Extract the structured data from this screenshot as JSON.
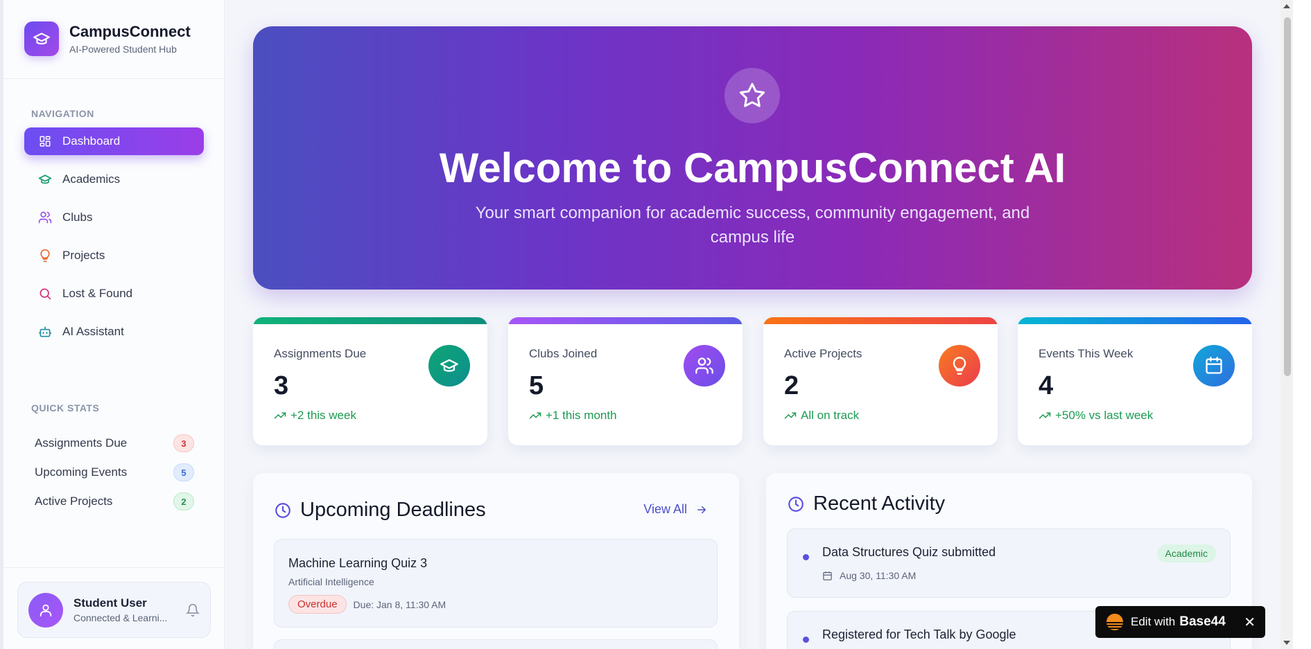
{
  "brand": {
    "name": "CampusConnect",
    "tagline": "AI-Powered Student Hub",
    "logo_icon": "graduation-cap-icon"
  },
  "sidebar": {
    "nav_label": "NAVIGATION",
    "items": [
      {
        "label": "Dashboard",
        "icon": "dashboard-icon",
        "active": true
      },
      {
        "label": "Academics",
        "icon": "graduation-cap-icon",
        "color": "#129b6a"
      },
      {
        "label": "Clubs",
        "icon": "users-icon",
        "color": "#9b4ee8"
      },
      {
        "label": "Projects",
        "icon": "lightbulb-icon",
        "color": "#e8622a"
      },
      {
        "label": "Lost & Found",
        "icon": "search-icon",
        "color": "#d02f79"
      },
      {
        "label": "AI Assistant",
        "icon": "bot-icon",
        "color": "#1d8fa8"
      }
    ],
    "quick_stats_label": "QUICK STATS",
    "quick_stats": [
      {
        "label": "Assignments Due",
        "value": "3",
        "color": "red"
      },
      {
        "label": "Upcoming Events",
        "value": "5",
        "color": "blue"
      },
      {
        "label": "Active Projects",
        "value": "2",
        "color": "green"
      }
    ],
    "user": {
      "name": "Student User",
      "status": "Connected & Learni..."
    }
  },
  "hero": {
    "title": "Welcome to CampusConnect AI",
    "subtitle": "Your smart companion for academic success, community engagement, and campus life",
    "icon": "star-icon"
  },
  "stat_cards": [
    {
      "label": "Assignments Due",
      "value": "3",
      "trend": "+2 this week",
      "icon": "graduation-cap-icon",
      "bar": "#10a37f",
      "gradient": [
        "#0fa573",
        "#0d8f8f"
      ]
    },
    {
      "label": "Clubs Joined",
      "value": "5",
      "trend": "+1 this month",
      "icon": "users-icon",
      "bar": "#8f4ef0",
      "gradient": [
        "#a14cf0",
        "#6a4ee8"
      ]
    },
    {
      "label": "Active Projects",
      "value": "2",
      "trend": "All on track",
      "icon": "lightbulb-icon",
      "bar": "#f15a2e",
      "gradient": [
        "#f77d1e",
        "#ec3b4e"
      ]
    },
    {
      "label": "Events This Week",
      "value": "4",
      "trend": "+50% vs last week",
      "icon": "calendar-icon",
      "bar": "#1b8fdc",
      "gradient": [
        "#10a7d8",
        "#2f6fe0"
      ]
    }
  ],
  "deadlines": {
    "title": "Upcoming Deadlines",
    "view_all": "View All",
    "items": [
      {
        "title": "Machine Learning Quiz 3",
        "subject": "Artificial Intelligence",
        "status": "Overdue",
        "due": "Due: Jan 8, 11:30 AM"
      }
    ]
  },
  "activity": {
    "title": "Recent Activity",
    "items": [
      {
        "title": "Data Structures Quiz submitted",
        "date": "Aug 30, 11:30 AM",
        "tag": "Academic"
      },
      {
        "title": "Registered for Tech Talk by Google",
        "date": "",
        "tag": ""
      }
    ]
  },
  "base44": {
    "prefix": "Edit with",
    "brand": "Base44",
    "close": "✕"
  }
}
